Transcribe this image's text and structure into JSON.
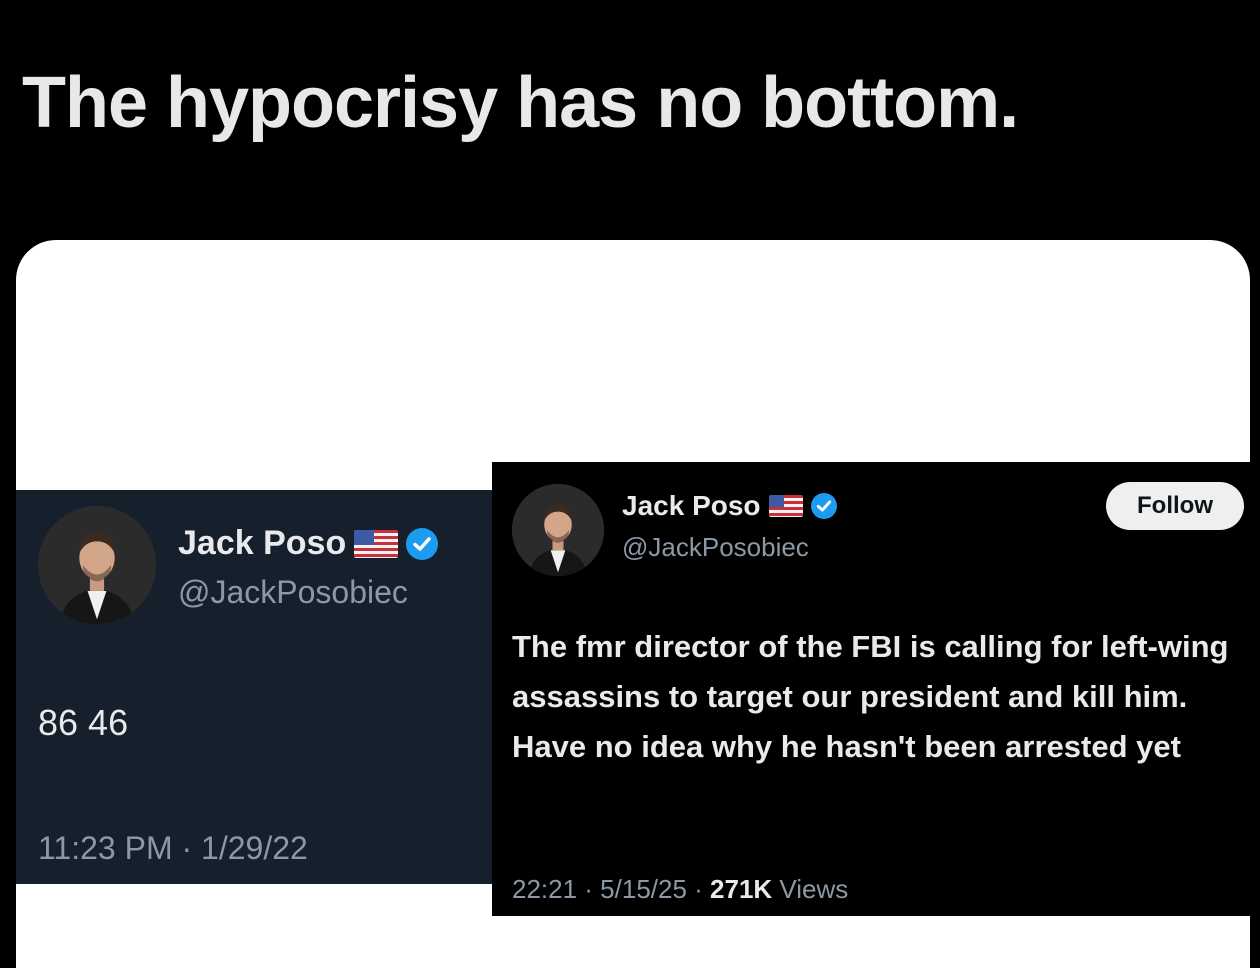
{
  "headline": "The hypocrisy has no bottom.",
  "colors": {
    "page_background": "#000000",
    "card_background": "#ffffff",
    "left_tweet_background": "#16202d",
    "right_tweet_background": "#000000",
    "verified_badge": "#1d9bf0",
    "secondary_text": "#8b98a5"
  },
  "tweet_left": {
    "display_name": "Jack Poso",
    "name_emoji_icon": "us-flag-icon",
    "badge_icon": "verified-badge-icon",
    "handle": "@JackPosobiec",
    "text": "86 46",
    "timestamp": "11:23 PM · 1/29/22"
  },
  "tweet_right": {
    "display_name": "Jack Poso",
    "name_emoji_icon": "us-flag-icon",
    "badge_icon": "verified-badge-icon",
    "handle": "@JackPosobiec",
    "follow_label": "Follow",
    "text": "The fmr director of the FBI is calling for left-wing assassins to target our president and kill him. Have no idea why he hasn't been arrested yet",
    "timestamp": "22:21 · 5/15/25 · ",
    "views_count": "271K",
    "views_label": " Views"
  }
}
